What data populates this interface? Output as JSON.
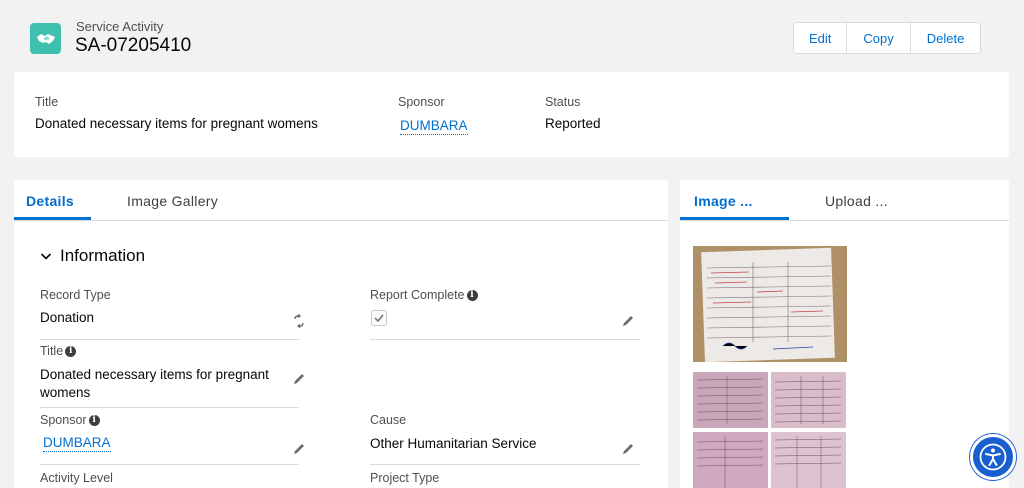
{
  "header": {
    "object_type": "Service Activity",
    "record_name": "SA-07205410",
    "icon": "handshake-icon",
    "buttons": {
      "edit": "Edit",
      "copy": "Copy",
      "delete": "Delete"
    }
  },
  "highlights": {
    "title_label": "Title",
    "title_value": "Donated necessary items for pregnant womens",
    "sponsor_label": "Sponsor",
    "sponsor_value": "DUMBARA",
    "status_label": "Status",
    "status_value": "Reported"
  },
  "details": {
    "tabs": [
      "Details",
      "Image Gallery"
    ],
    "active_tab": "Details",
    "section_title": "Information",
    "fields": {
      "record_type_label": "Record Type",
      "record_type_value": "Donation",
      "report_complete_label": "Report Complete",
      "report_complete_checked": true,
      "title_label": "Title",
      "title_value": "Donated necessary items for pregnant womens",
      "sponsor_label": "Sponsor",
      "sponsor_value": "DUMBARA",
      "cause_label": "Cause",
      "cause_value": "Other Humanitarian Service",
      "activity_level_label": "Activity Level",
      "project_type_label": "Project Type"
    }
  },
  "side_panel": {
    "tabs": [
      "Image ...",
      "Upload ..."
    ],
    "active_tab": "Image ..."
  },
  "colors": {
    "brand_link": "#0070d2",
    "object_icon_bg": "#3fbfad",
    "accessibility_button": "#1a5fd0"
  }
}
